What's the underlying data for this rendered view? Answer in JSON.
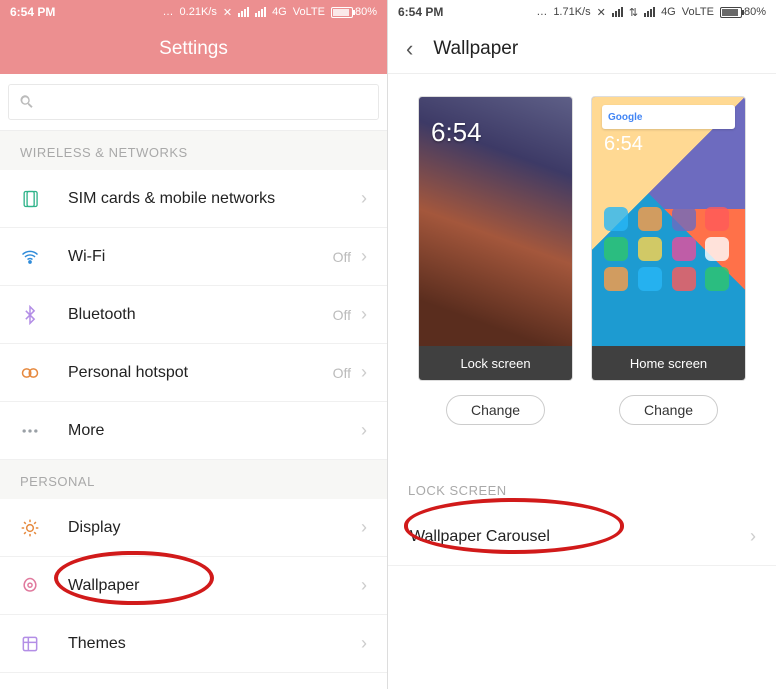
{
  "status": {
    "time": "6:54 PM",
    "speed_left": "0.21K/s",
    "speed_right": "1.71K/s",
    "net": "4G",
    "volte": "VoLTE",
    "battery_pct": "80%"
  },
  "left": {
    "header_title": "Settings",
    "sections": {
      "wireless_label": "WIRELESS & NETWORKS",
      "personal_label": "PERSONAL"
    },
    "rows": {
      "sim": {
        "label": "SIM cards & mobile networks",
        "value": ""
      },
      "wifi": {
        "label": "Wi-Fi",
        "value": "Off"
      },
      "bt": {
        "label": "Bluetooth",
        "value": "Off"
      },
      "hotspot": {
        "label": "Personal hotspot",
        "value": "Off"
      },
      "more": {
        "label": "More",
        "value": ""
      },
      "display": {
        "label": "Display",
        "value": ""
      },
      "wallpaper": {
        "label": "Wallpaper",
        "value": ""
      },
      "themes": {
        "label": "Themes",
        "value": ""
      }
    }
  },
  "right": {
    "header_title": "Wallpaper",
    "lockscreen_caption": "Lock screen",
    "homescreen_caption": "Home screen",
    "change_label": "Change",
    "section_lockscreen": "LOCK SCREEN",
    "row_carousel": "Wallpaper Carousel",
    "preview_clock": "6:54",
    "google_label": "Google"
  }
}
